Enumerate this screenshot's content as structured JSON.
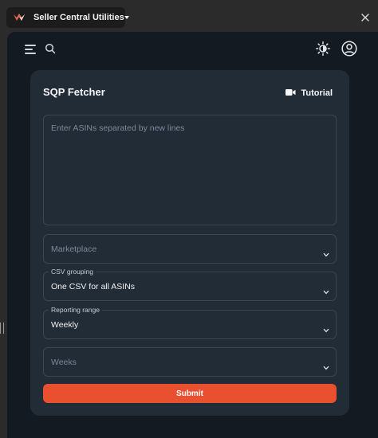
{
  "extension": {
    "title": "Seller Central Utilities",
    "logo_icon": "extension-logo-icon",
    "dropdown_icon": "caret-down-icon"
  },
  "window": {
    "close_icon": "close-icon"
  },
  "toolbar": {
    "menu_icon": "hamburger-menu-icon",
    "search_icon": "search-icon",
    "theme_icon": "sun-icon",
    "account_icon": "user-circle-icon"
  },
  "card": {
    "title": "SQP Fetcher",
    "tutorial_label": "Tutorial",
    "tutorial_icon": "video-camera-icon"
  },
  "form": {
    "asins": {
      "placeholder": "Enter ASINs separated by new lines",
      "value": ""
    },
    "marketplace": {
      "placeholder": "Marketplace",
      "value": ""
    },
    "csv_grouping": {
      "label": "CSV grouping",
      "value": "One CSV for all ASINs"
    },
    "reporting_range": {
      "label": "Reporting range",
      "value": "Weekly"
    },
    "weeks": {
      "placeholder": "Weeks",
      "value": ""
    },
    "submit_label": "Submit"
  },
  "colors": {
    "accent": "#e8502f",
    "panel_bg": "#141a21",
    "card_bg": "#222c37",
    "border": "#3a4654"
  }
}
